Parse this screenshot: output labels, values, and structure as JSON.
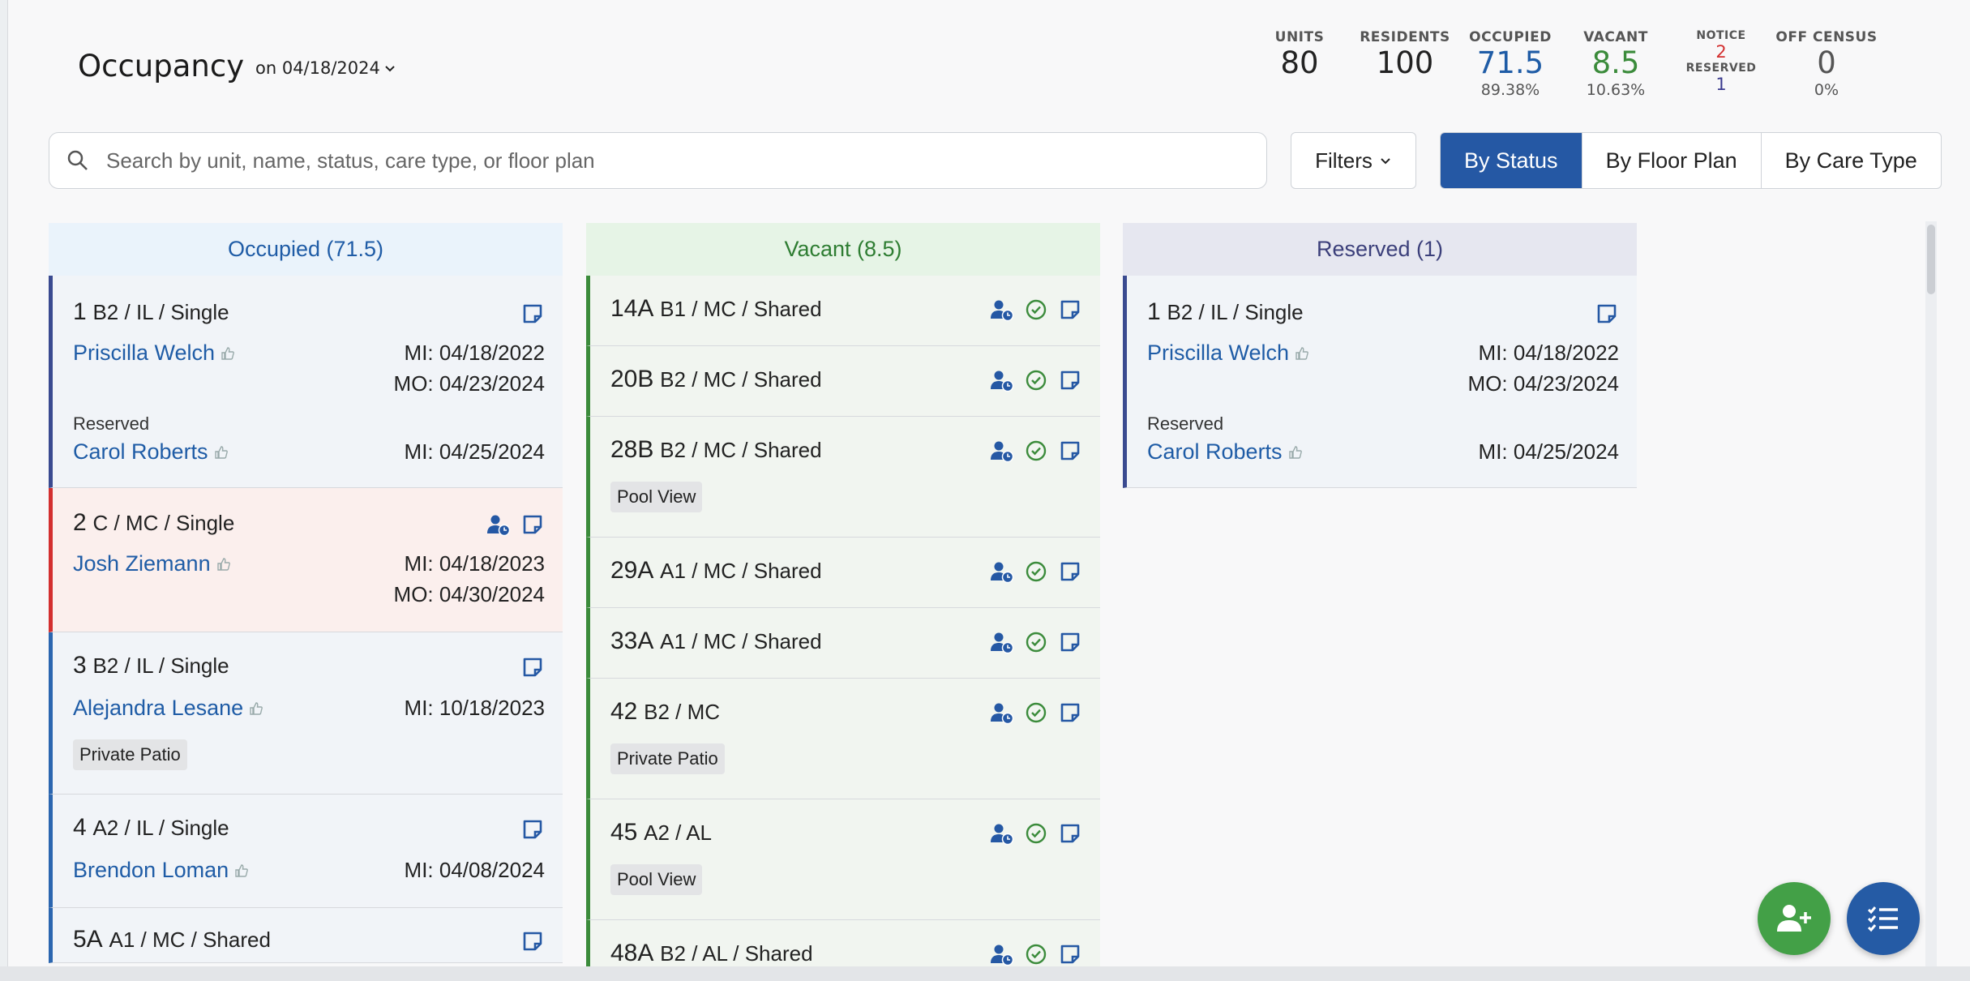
{
  "header": {
    "title": "Occupancy",
    "date_label": "on 04/18/2024"
  },
  "stats": {
    "units": {
      "label": "UNITS",
      "value": "80"
    },
    "residents": {
      "label": "RESIDENTS",
      "value": "100"
    },
    "occupied": {
      "label": "OCCUPIED",
      "value": "71.5",
      "pct": "89.38%"
    },
    "vacant": {
      "label": "VACANT",
      "value": "8.5",
      "pct": "10.63%"
    },
    "notice": {
      "label": "NOTICE",
      "value": "2",
      "reserved_label": "RESERVED",
      "reserved_value": "1"
    },
    "off_census": {
      "label": "OFF CENSUS",
      "value": "0",
      "pct": "0%"
    }
  },
  "search": {
    "placeholder": "Search by unit, name, status, care type, or floor plan",
    "value": ""
  },
  "filters_label": "Filters",
  "views": [
    "By Status",
    "By Floor Plan",
    "By Care Type"
  ],
  "active_view": "By Status",
  "columns": {
    "occupied": {
      "title": "Occupied (71.5)",
      "cards": [
        {
          "unit": "1",
          "meta": "B2 / IL / Single",
          "name": "Priscilla Welch",
          "mi": "MI: 04/18/2022",
          "mo": "MO: 04/23/2024",
          "reserved_label": "Reserved",
          "reserved_name": "Carol Roberts",
          "reserved_mi": "MI: 04/25/2024"
        },
        {
          "unit": "2",
          "meta": "C / MC / Single",
          "name": "Josh Ziemann",
          "mi": "MI: 04/18/2023",
          "mo": "MO: 04/30/2024"
        },
        {
          "unit": "3",
          "meta": "B2 / IL / Single",
          "name": "Alejandra Lesane",
          "mi": "MI: 10/18/2023",
          "tag": "Private Patio"
        },
        {
          "unit": "4",
          "meta": "A2 / IL / Single",
          "name": "Brendon Loman",
          "mi": "MI: 04/08/2024"
        },
        {
          "unit": "5A",
          "meta": "A1 / MC / Shared"
        }
      ]
    },
    "vacant": {
      "title": "Vacant (8.5)",
      "cards": [
        {
          "unit": "14A",
          "meta": "B1 / MC / Shared"
        },
        {
          "unit": "20B",
          "meta": "B2 / MC / Shared"
        },
        {
          "unit": "28B",
          "meta": "B2 / MC / Shared",
          "tag": "Pool View"
        },
        {
          "unit": "29A",
          "meta": "A1 / MC / Shared"
        },
        {
          "unit": "33A",
          "meta": "A1 / MC / Shared"
        },
        {
          "unit": "42",
          "meta": "B2 / MC",
          "tag": "Private Patio"
        },
        {
          "unit": "45",
          "meta": "A2 / AL",
          "tag": "Pool View"
        },
        {
          "unit": "48A",
          "meta": "B2 / AL / Shared"
        }
      ]
    },
    "reserved": {
      "title": "Reserved (1)",
      "cards": [
        {
          "unit": "1",
          "meta": "B2 / IL / Single",
          "name": "Priscilla Welch",
          "mi": "MI: 04/18/2022",
          "mo": "MO: 04/23/2024",
          "reserved_label": "Reserved",
          "reserved_name": "Carol Roberts",
          "reserved_mi": "MI: 04/25/2024"
        }
      ]
    }
  },
  "colors": {
    "primary": "#2558a4",
    "occupied": "#1f5ca6",
    "vacant": "#3b8b3b",
    "alert": "#d32f2f",
    "reserved": "#3b3f7a"
  }
}
